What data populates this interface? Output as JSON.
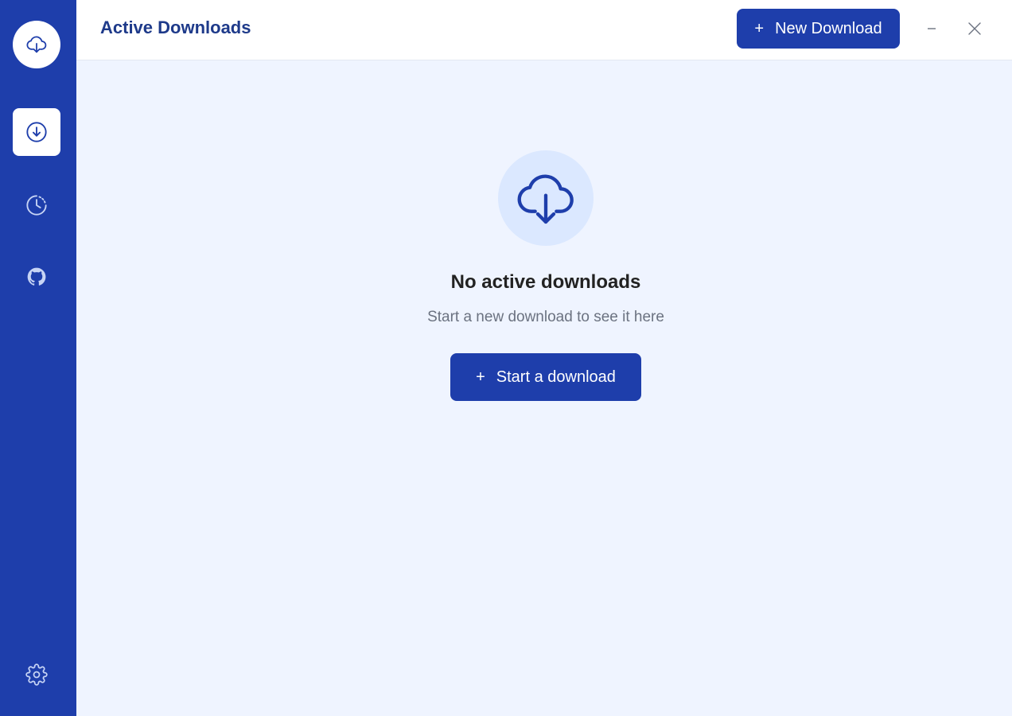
{
  "sidebar": {
    "logo_icon": "cloud-download-icon",
    "items": [
      {
        "id": "downloads",
        "icon": "download-circle-icon",
        "active": true
      },
      {
        "id": "history",
        "icon": "clock-icon",
        "active": false
      },
      {
        "id": "github",
        "icon": "github-icon",
        "active": false
      }
    ],
    "settings_icon": "gear-icon"
  },
  "header": {
    "title": "Active Downloads",
    "new_download_icon": "+",
    "new_download_label": "New Download"
  },
  "window_controls": [
    "minimize-icon",
    "close-icon"
  ],
  "empty_state": {
    "icon": "cloud-download-icon",
    "title": "No active downloads",
    "subtitle": "Start a new download to see it here",
    "button_icon": "+",
    "button_label": "Start a download"
  },
  "colors": {
    "sidebar": "#1e3eab",
    "accent": "#1e3eab",
    "background": "#eff4ff",
    "icon_bg": "#dbe8ff",
    "title": "#1e3a8a"
  }
}
